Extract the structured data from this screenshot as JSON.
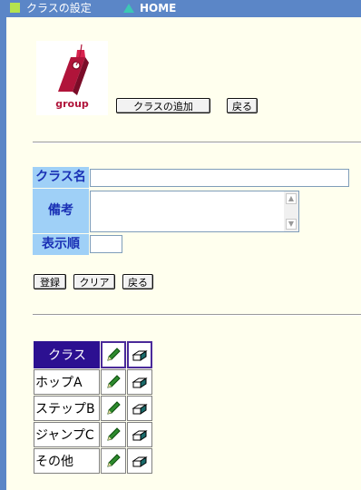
{
  "header": {
    "title": "クラスの設定",
    "home_label": "HOME",
    "accent_square": "#b5e34e",
    "accent_triangle": "#3cc8b4"
  },
  "logo": {
    "text": "group",
    "color": "#b0143a"
  },
  "toolbar": {
    "add_class_label": "クラスの追加",
    "back_label": "戻る"
  },
  "form": {
    "class_name_label": "クラス名",
    "class_name_value": "",
    "memo_label": "備考",
    "memo_value": "",
    "display_order_label": "表示順",
    "display_order_value": "",
    "register_label": "登録",
    "clear_label": "クリア",
    "back_label": "戻る"
  },
  "class_table": {
    "header": "クラス",
    "rows": [
      {
        "name": "ホップA"
      },
      {
        "name": "ステップB"
      },
      {
        "name": "ジャンプC"
      },
      {
        "name": "その他"
      }
    ],
    "edit_icon": "pencil-icon",
    "delete_icon": "eraser-icon"
  }
}
